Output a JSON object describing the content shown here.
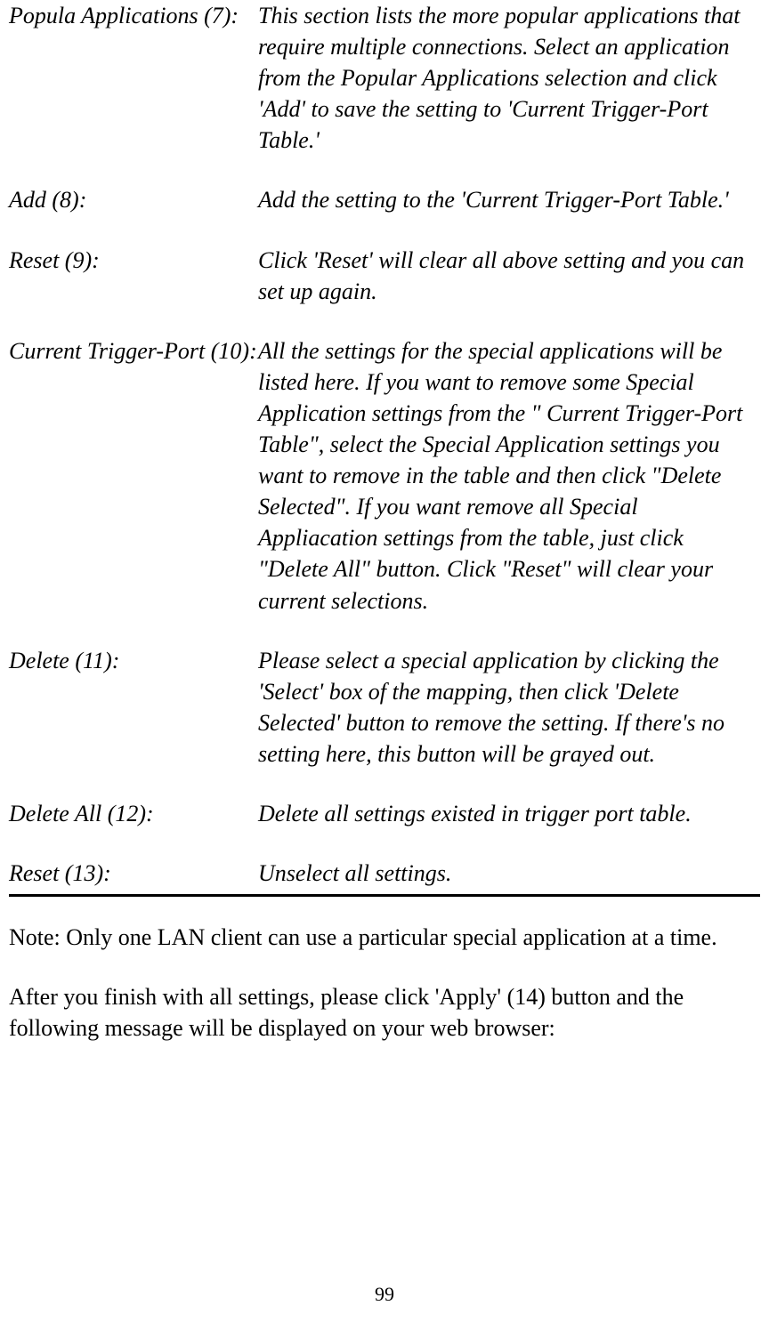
{
  "definitions": [
    {
      "label": "Popula Applications (7):",
      "desc": "This section lists the more popular applications that require multiple connections. Select an application from the Popular Applications selection and click 'Add' to save the setting to 'Current Trigger-Port Table.'"
    },
    {
      "label": "Add (8):",
      "desc": "Add the setting to the 'Current Trigger-Port Table.'"
    },
    {
      "label": "Reset (9):",
      "desc": "Click 'Reset' will clear all above setting and you can set up again."
    },
    {
      "label": "Current Trigger-Port (10):",
      "desc": "All the settings for the special applications will be listed here. If you want to remove some Special Application settings from the \" Current Trigger-Port Table\", select the Special Application settings you want to remove in the table and then click \"Delete Selected\". If you want remove all Special Appliacation settings from the table, just click \"Delete All\" button. Click \"Reset\" will clear your current selections."
    },
    {
      "label": "Delete (11):",
      "desc": "Please select a special application by clicking the 'Select' box of the mapping, then click 'Delete Selected' button to remove the setting. If there's no setting here, this button will be grayed out."
    },
    {
      "label": "Delete All (12):",
      "desc": "Delete all settings existed in trigger port table."
    },
    {
      "label": "Reset (13):",
      "desc": "Unselect all settings."
    }
  ],
  "notes": {
    "note1": "Note: Only one LAN client can use a particular special application at a time.",
    "note2": "After you finish with all settings, please click 'Apply' (14) button and the following message will be displayed on your web browser:"
  },
  "page_number": "99"
}
